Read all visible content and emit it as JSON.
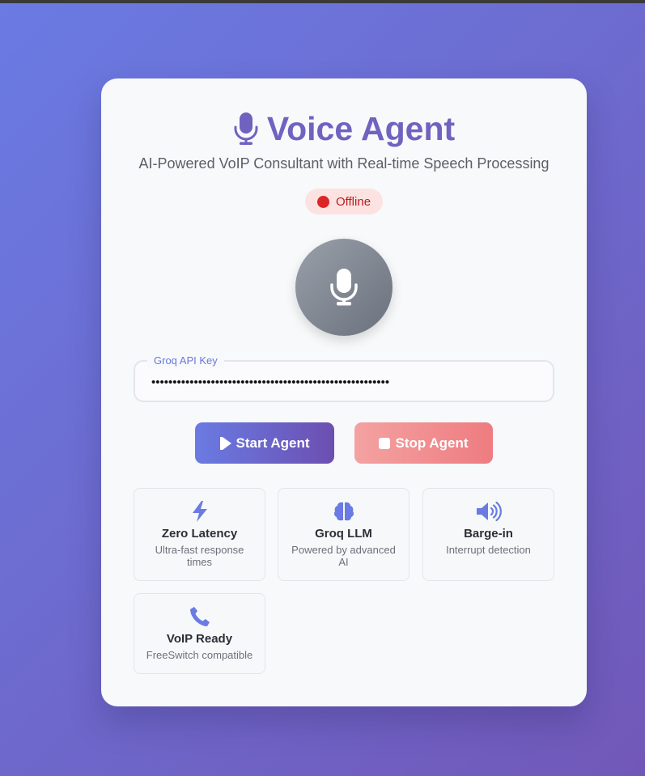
{
  "header": {
    "title": "Voice Agent",
    "subtitle": "AI-Powered VoIP Consultant with Real-time Speech Processing"
  },
  "status": {
    "text": "Offline",
    "color": "#dc2626"
  },
  "api_key": {
    "label": "Groq API Key",
    "value": "••••••••••••••••••••••••••••••••••••••••••••••••••••••••"
  },
  "controls": {
    "start_label": "Start Agent",
    "stop_label": "Stop Agent"
  },
  "features": [
    {
      "icon": "bolt-icon",
      "name": "Zero Latency",
      "desc": "Ultra-fast response times"
    },
    {
      "icon": "brain-icon",
      "name": "Groq LLM",
      "desc": "Powered by advanced AI"
    },
    {
      "icon": "speaker-icon",
      "name": "Barge-in",
      "desc": "Interrupt detection"
    },
    {
      "icon": "phone-icon",
      "name": "VoIP Ready",
      "desc": "FreeSwitch compatible"
    }
  ],
  "colors": {
    "accent": "#6f63c0",
    "icon": "#6a7be3",
    "start_gradient": [
      "#6a7be3",
      "#6c4fb1"
    ],
    "stop_gradient": [
      "#f4a2a2",
      "#ee7c80"
    ]
  }
}
